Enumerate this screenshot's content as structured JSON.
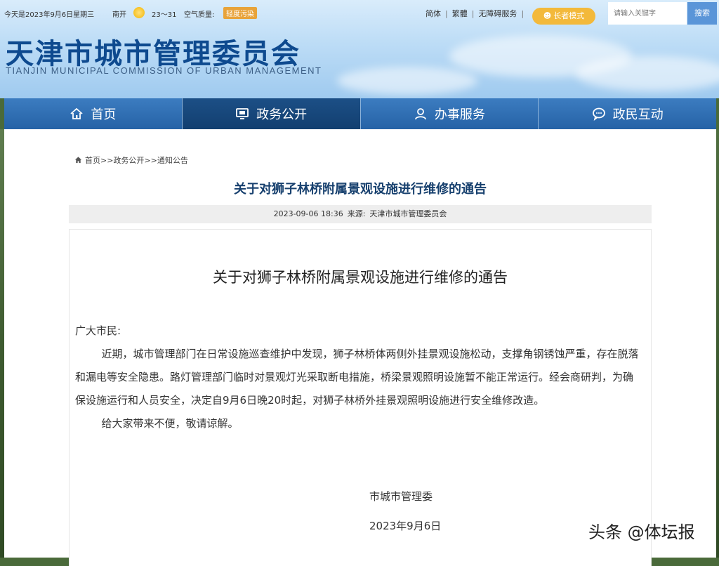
{
  "topbar": {
    "date_text": "今天是2023年9月6日星期三",
    "city": "南开",
    "weather_icon": "sun-icon",
    "temperature": "23～31",
    "air_quality_label": "空气质量:",
    "air_quality_value": "轻度污染"
  },
  "toplinks": {
    "simplified": "简体",
    "traditional": "繁體",
    "accessibility": "无障碍服务",
    "elder_mode": "长者模式"
  },
  "search": {
    "placeholder": "请输入关键字",
    "button_label": "搜索"
  },
  "site": {
    "title": "天津市城市管理委员会",
    "subtitle": "TIANJIN MUNICIPAL COMMISSION OF URBAN MANAGEMENT"
  },
  "nav": {
    "items": [
      {
        "label": "首页",
        "icon": "home-icon"
      },
      {
        "label": "政务公开",
        "icon": "monitor-icon",
        "active": true
      },
      {
        "label": "办事服务",
        "icon": "user-icon"
      },
      {
        "label": "政民互动",
        "icon": "chat-icon"
      }
    ]
  },
  "breadcrumb": {
    "home": "首页",
    "sep": ">>",
    "level1": "政务公开",
    "level2": "通知公告"
  },
  "article": {
    "title": "关于对狮子林桥附属景观设施进行维修的通告",
    "datetime": "2023-09-06 18:36",
    "source_label": "来源:",
    "source": "天津市城市管理委员会",
    "doc_title": "关于对狮子林桥附属景观设施进行维修的通告",
    "salutation": "广大市民:",
    "paragraph1": "近期，城市管理部门在日常设施巡查维护中发现，狮子林桥体两侧外挂景观设施松动，支撑角钢锈蚀严重，存在脱落和漏电等安全隐患。路灯管理部门临时对景观灯光采取断电措施，桥梁景观照明设施暂不能正常运行。经会商研判，为确保设施运行和人员安全，决定自9月6日晚20时起，对狮子林桥外挂景观照明设施进行安全维修改造。",
    "paragraph2": "给大家带来不便，敬请谅解。",
    "signature": "市城市管理委",
    "signature_date": "2023年9月6日"
  },
  "watermark": "头条 @体坛报",
  "colors": {
    "nav_blue": "#2a6aae",
    "nav_active": "#123f70",
    "title_blue": "#0e4a8f",
    "elder_orange": "#f3b93b",
    "search_blue": "#5a95d8"
  }
}
